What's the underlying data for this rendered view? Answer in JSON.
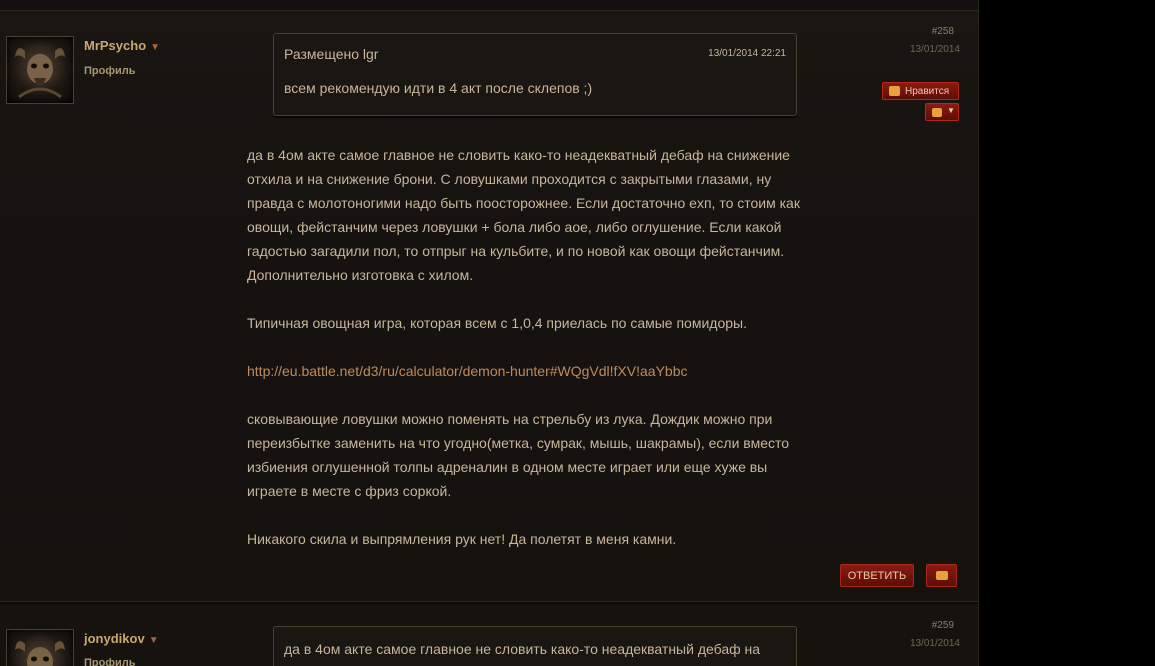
{
  "posts": [
    {
      "author": "MrPsycho",
      "profile_label": "Профиль",
      "number": "#258",
      "date": "13/01/2014",
      "quote": {
        "header": "Размещено lgr",
        "time": "13/01/2014 22:21",
        "text": "всем рекомендую идти в 4 акт после склепов ;)"
      },
      "like_label": "Нравится",
      "body": [
        "да в 4ом акте самое главное не словить како-то неадекватный дебаф на снижение отхила и на снижение брони. С ловушками проходится с закрытыми глазами, ну правда с молотоногими надо быть поосторожнее. Если достаточно exп, то стоим как овощи, фейстанчим через ловушки + бола либо аое, либо оглушение. Если какой гадостью загадили пол, то отпрыг на кульбите, и по новой как овощи фейстанчим. Дополнительно изготовка с хилом.",
        "Типичная овощная игра, которая всем с 1,0,4 приелась по самые помидоры.",
        "http://eu.battle.net/d3/ru/calculator/demon-hunter#WQgVdl!fXV!aaYbbc",
        "сковывающие ловушки можно поменять на стрельбу из лука. Дождик можно при переизбытке заменить на что угодно(метка, сумрак, мышь, шакрамы), если вместо избиения оглушенной толпы адреналин в одном месте играет или еще хуже вы играете в месте с фриз соркой.",
        "Никакого скила и выпрямления рук нет! Да полетят в меня камни."
      ],
      "reply_label": "ОТВЕТИТЬ"
    },
    {
      "author": "jonydikov",
      "profile_label": "Профиль",
      "number": "#259",
      "date": "13/01/2014",
      "quote": {
        "text": "да в 4ом акте самое главное не словить како-то неадекватный дебаф на"
      }
    }
  ],
  "icons": {
    "like": "thumbs-up-icon",
    "dislike": "thumbs-down-icon",
    "quote": "speech-bubble-icon",
    "menu": "chevron-down-icon"
  },
  "colors": {
    "background": "#16130f",
    "text": "#c8b59a",
    "author": "#c8a870",
    "button": "#8a1b12",
    "link": "#c08a5a"
  }
}
